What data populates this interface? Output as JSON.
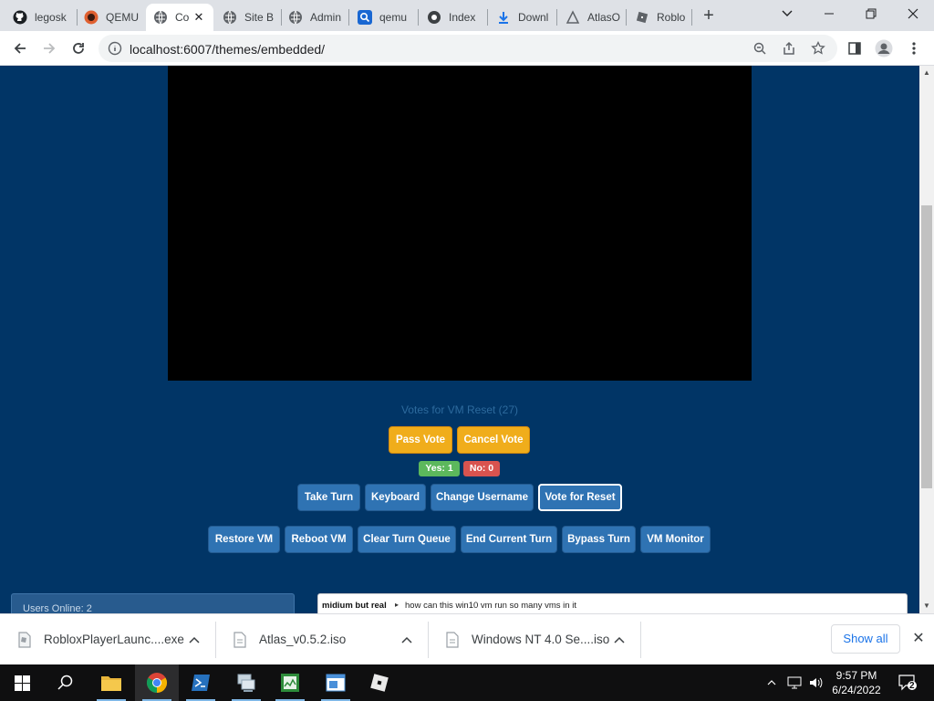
{
  "browser": {
    "tabs": [
      {
        "label": "legosk",
        "icon": "github-icon"
      },
      {
        "label": "QEMU",
        "icon": "qemu-icon"
      },
      {
        "label": "Co",
        "icon": "globe-icon",
        "active": true
      },
      {
        "label": "Site B",
        "icon": "globe-icon"
      },
      {
        "label": "Admin",
        "icon": "globe-icon"
      },
      {
        "label": "qemu",
        "icon": "search-icon"
      },
      {
        "label": "Index",
        "icon": "globe-icon"
      },
      {
        "label": "Downl",
        "icon": "download-icon"
      },
      {
        "label": "AtlasO",
        "icon": "triangle-icon"
      },
      {
        "label": "Roblo",
        "icon": "roblox-icon"
      }
    ],
    "new_tab": "+",
    "url": "localhost:6007/themes/embedded/"
  },
  "vm": {
    "votes_title": "Votes for VM Reset (27)",
    "pass_vote": "Pass Vote",
    "cancel_vote": "Cancel Vote",
    "yes": "Yes: 1",
    "no": "No: 0",
    "actions": [
      "Take Turn",
      "Keyboard",
      "Change Username",
      "Vote for Reset"
    ],
    "admin_actions": [
      "Restore VM",
      "Reboot VM",
      "Clear Turn Queue",
      "End Current Turn",
      "Bypass Turn",
      "VM Monitor"
    ],
    "users_online": "Users Online: 2",
    "chat": {
      "user": "midium but real",
      "separator": "▸",
      "message": "how can this win10 vm run so many vms in it"
    }
  },
  "downloads": {
    "items": [
      "RobloxPlayerLaunc....exe",
      "Atlas_v0.5.2.iso",
      "Windows NT 4.0 Se....iso"
    ],
    "show_all": "Show all"
  },
  "taskbar": {
    "time": "9:57 PM",
    "date": "6/24/2022",
    "notifications": "2"
  },
  "colors": {
    "page_bg": "#013566",
    "orange_button": "#f0ad1b",
    "blue_button": "#2f73b3",
    "yes_badge": "#5cb85c",
    "no_badge": "#d9534f"
  }
}
